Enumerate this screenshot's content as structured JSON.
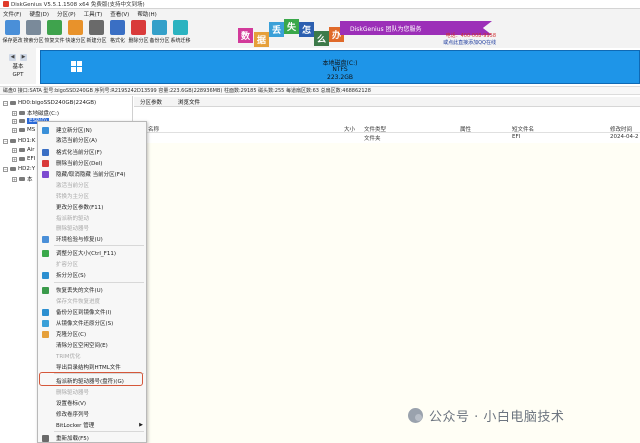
{
  "window": {
    "title": "DiskGenius V5.5.1.1508 x64 免费版(支持中文到场)"
  },
  "menu": [
    "文件(F)",
    "硬盘(D)",
    "分区(P)",
    "工具(T)",
    "查看(V)",
    "帮助(H)"
  ],
  "toolbar": [
    {
      "label": "保存更改",
      "color": "#4a8fd8"
    },
    {
      "label": "搜索分区",
      "color": "#7a8a9a"
    },
    {
      "label": "恢复文件",
      "color": "#3fa34d"
    },
    {
      "label": "快速分区",
      "color": "#e8922b"
    },
    {
      "label": "新建分区",
      "color": "#6a6a6a"
    },
    {
      "label": "格式化",
      "color": "#3a6fc4"
    },
    {
      "label": "删除分区",
      "color": "#d93a3a"
    },
    {
      "label": "备份分区",
      "color": "#34a0c9"
    },
    {
      "label": "系统迁移",
      "color": "#2bb3c0"
    }
  ],
  "banner": {
    "chars": [
      {
        "t": "数",
        "color": "#d23a9a"
      },
      {
        "t": "据",
        "color": "#e6a03a"
      },
      {
        "t": "丢",
        "color": "#3aa0d8"
      },
      {
        "t": "失",
        "color": "#3aa84a"
      },
      {
        "t": "怎",
        "color": "#2c5fb0"
      },
      {
        "t": "么",
        "color": "#3c7a4a"
      },
      {
        "t": "办",
        "color": "#e06a2a"
      }
    ],
    "slogan": "DiskGenius 团队为您服务",
    "phone": "电话：400-008-9958",
    "qq": "或点此直接添加QQ在线"
  },
  "disk": {
    "nav_top": "基本",
    "nav_bottom": "GPT",
    "title": "本地磁盘(C:)",
    "fs": "NTFS",
    "size": "223.2GB"
  },
  "infoline": "磁盘0 接口:SATA 型号:bigoSSD240GB 序列号:R2195242D13599 容量:223.6GB(228936MB) 柱面数:29185 磁头数:255 每道扇区数:63 总扇区数:468862128",
  "tree": {
    "hd0": "HD0:bigoSSD240GB(224GB)",
    "c": "本地磁盘(C:)",
    "esp": "ESP(0)",
    "msr": "MS",
    "hd1": "HD1:K",
    "air": "Air",
    "efi": "EFI",
    "hd2": "HD2:Y",
    "bendi": "本"
  },
  "tabs": [
    "分区参数",
    "浏览文件"
  ],
  "columns": [
    "名称",
    "大小",
    "文件类型",
    "属性",
    "短文件名",
    "修改时间"
  ],
  "file_row": {
    "name": "",
    "type": "文件夹",
    "short": "EFI",
    "date": "2024-04-2"
  },
  "context_menu": [
    {
      "label": "建立新分区(N)",
      "icon": "#3a8fd8",
      "disabled": false
    },
    {
      "label": "激活当前分区(A)",
      "icon": "",
      "disabled": false
    },
    {
      "label": "格式化当前分区(F)",
      "icon": "#3a6fc4",
      "disabled": false
    },
    {
      "label": "删除当前分区(Del)",
      "icon": "#d93a3a",
      "disabled": false
    },
    {
      "label": "隐藏/取消隐藏 当前分区(F4)",
      "icon": "#7c4ad0",
      "disabled": false
    },
    {
      "label": "激活当前分区",
      "icon": "",
      "disabled": true
    },
    {
      "label": "转换为主分区",
      "icon": "",
      "disabled": true
    },
    {
      "label": "更改分区参数(F11)",
      "icon": "",
      "disabled": false
    },
    {
      "label": "指派新的驱动",
      "icon": "",
      "disabled": true
    },
    {
      "label": "删除驱动器号",
      "icon": "",
      "disabled": true
    },
    {
      "label": "环境检验与修复(U)",
      "icon": "#4a8fd8",
      "disabled": false
    },
    {
      "label": "调整分区大小(Ctrl_F11)",
      "icon": "#3aa84a",
      "disabled": false
    },
    {
      "label": "扩容分区",
      "icon": "",
      "disabled": true
    },
    {
      "label": "拆分分区(S)",
      "icon": "#2c8fd0",
      "disabled": false
    },
    {
      "label": "恢复丢失的文件(U)",
      "icon": "#3a9a4a",
      "disabled": false
    },
    {
      "label": "保存文件恢复进度",
      "icon": "",
      "disabled": true
    },
    {
      "label": "备份分区到镜像文件(I)",
      "icon": "#2c8fd0",
      "disabled": false
    },
    {
      "label": "从镜像文件还原分区(S)",
      "icon": "#3aa0d8",
      "disabled": false
    },
    {
      "label": "克隆分区(C)",
      "icon": "#e6a03a",
      "disabled": false
    },
    {
      "label": "清除分区空闲空间(E)",
      "icon": "",
      "disabled": false
    },
    {
      "label": "TRIM优化",
      "icon": "",
      "disabled": true
    },
    {
      "label": "导出目录结构到HTML文件",
      "icon": "",
      "disabled": false
    },
    {
      "label": "指派新的驱动器号(盘符)(G)",
      "icon": "",
      "disabled": false
    },
    {
      "label": "删除驱动器号",
      "icon": "",
      "disabled": true
    },
    {
      "label": "设置卷标(V)",
      "icon": "",
      "disabled": false
    },
    {
      "label": "修改卷序列号",
      "icon": "",
      "disabled": false
    },
    {
      "label": "BitLocker 管理",
      "icon": "",
      "disabled": false
    },
    {
      "label": "重新加载(F5)",
      "icon": "#6a6a6a",
      "disabled": false
    }
  ],
  "watermark": "公众号 · 小白电脑技术"
}
